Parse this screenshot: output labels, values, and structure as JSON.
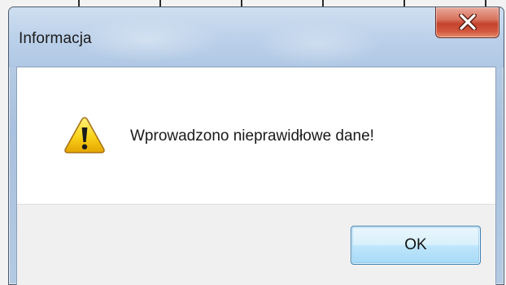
{
  "window": {
    "title": "Informacja",
    "close_icon": "close-icon",
    "close_color": "#c4432c",
    "titlebar_color": "#b5cbe4"
  },
  "message": {
    "icon": "warning-icon",
    "icon_color": "#f5c400",
    "text": "Wprowadzono nieprawidłowe dane!"
  },
  "buttons": {
    "ok_label": "OK",
    "ok_color": "#bee6fd"
  }
}
